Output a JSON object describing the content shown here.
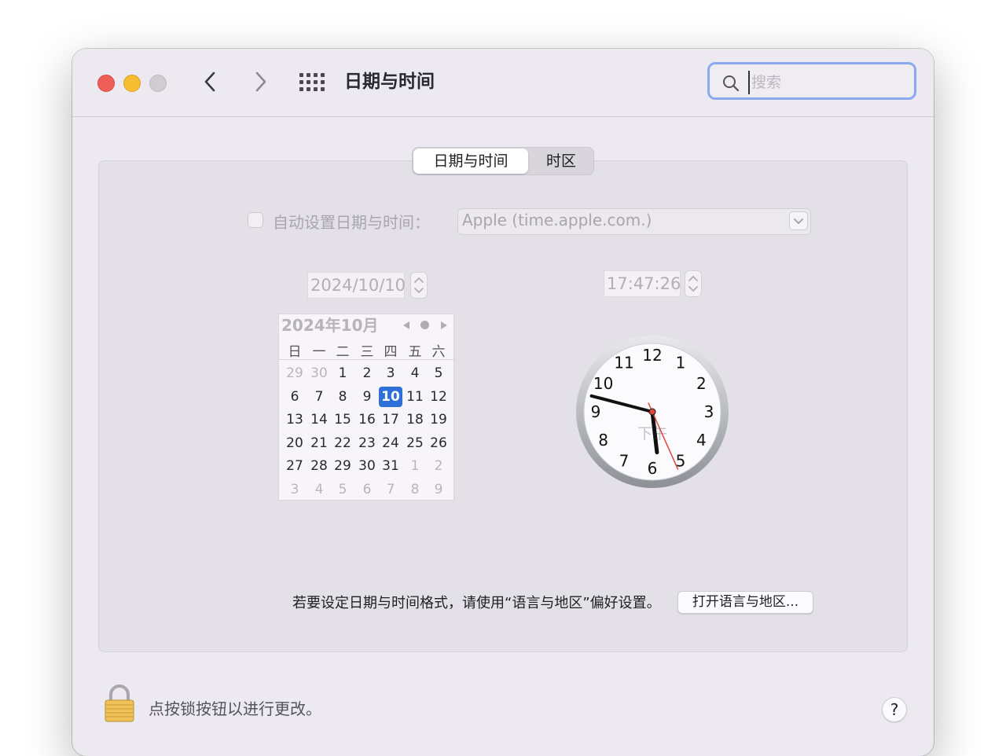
{
  "window": {
    "title": "日期与时间"
  },
  "search": {
    "placeholder": "搜索",
    "value": ""
  },
  "tabs": [
    {
      "label": "日期与时间",
      "active": true
    },
    {
      "label": "时区",
      "active": false
    }
  ],
  "auto_time": {
    "label": "自动设置日期与时间：",
    "checked": false,
    "server": "Apple (time.apple.com.)"
  },
  "date_field": {
    "value": "2024/10/10"
  },
  "time_field": {
    "value": "17:47:26"
  },
  "calendar": {
    "title": "2024年10月",
    "weekdays": [
      "日",
      "一",
      "二",
      "三",
      "四",
      "五",
      "六"
    ],
    "weeks": [
      [
        "29",
        "30",
        "1",
        "2",
        "3",
        "4",
        "5"
      ],
      [
        "6",
        "7",
        "8",
        "9",
        "10",
        "11",
        "12"
      ],
      [
        "13",
        "14",
        "15",
        "16",
        "17",
        "18",
        "19"
      ],
      [
        "20",
        "21",
        "22",
        "23",
        "24",
        "25",
        "26"
      ],
      [
        "27",
        "28",
        "29",
        "30",
        "31",
        "1",
        "2"
      ],
      [
        "3",
        "4",
        "5",
        "6",
        "7",
        "8",
        "9"
      ]
    ],
    "other_month": [
      [
        0,
        0
      ],
      [
        0,
        1
      ],
      [
        4,
        5
      ],
      [
        4,
        6
      ],
      [
        5,
        0
      ],
      [
        5,
        1
      ],
      [
        5,
        2
      ],
      [
        5,
        3
      ],
      [
        5,
        4
      ],
      [
        5,
        5
      ],
      [
        5,
        6
      ]
    ],
    "selected": "10"
  },
  "clock": {
    "numbers": [
      "12",
      "1",
      "2",
      "3",
      "4",
      "5",
      "6",
      "7",
      "8",
      "9",
      "10",
      "11"
    ],
    "ampm": "下午",
    "hour": 17,
    "minute": 47,
    "second": 26
  },
  "format_note": {
    "text": "若要设定日期与时间格式，请使用“语言与地区”偏好设置。",
    "button": "打开语言与地区..."
  },
  "lock": {
    "text": "点按锁按钮以进行更改。"
  },
  "help": {
    "label": "?"
  },
  "colors": {
    "accent": "#2f6fd8",
    "search_focus": "#8aa9ee",
    "second_hand": "#e0453a"
  }
}
